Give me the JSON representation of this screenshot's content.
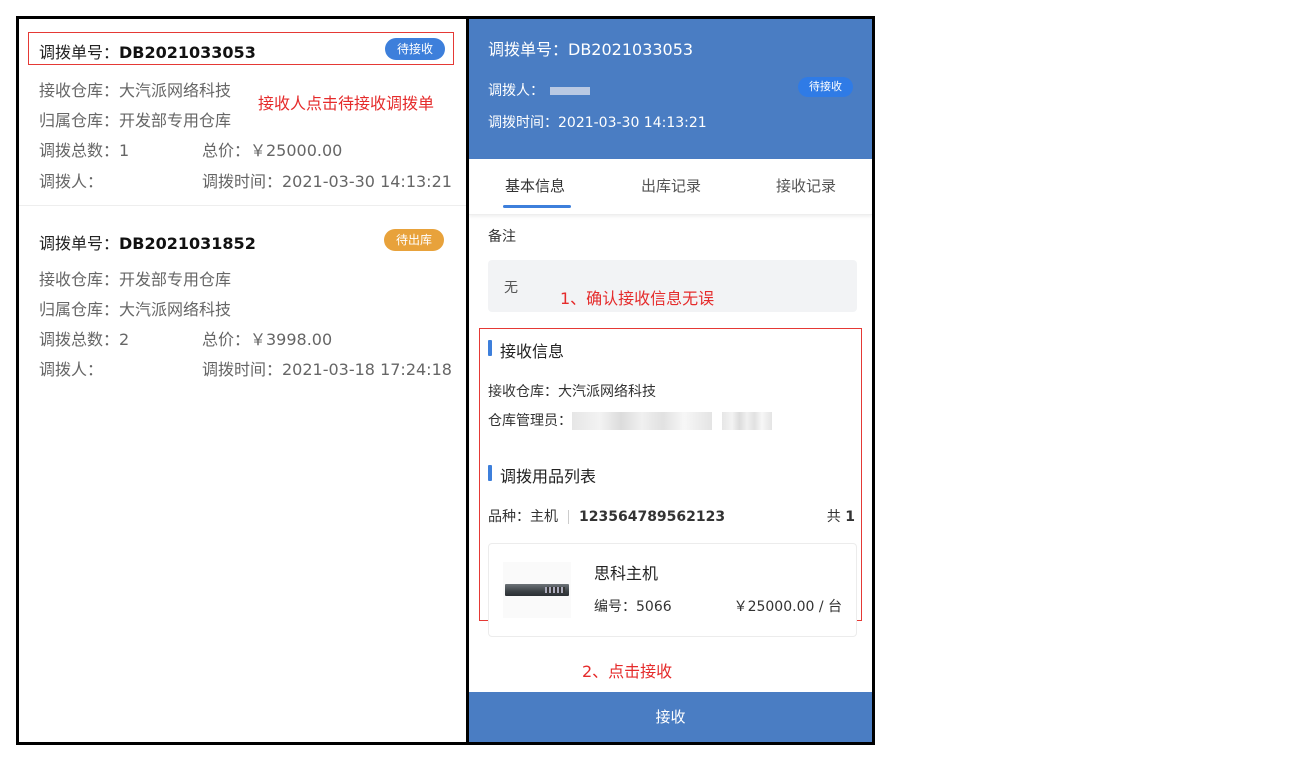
{
  "list": {
    "cards": [
      {
        "order_label": "调拨单号：",
        "order_no": "DB2021033053",
        "status": "待接收",
        "receive_wh": "接收仓库：大汽派网络科技",
        "owner_wh": "归属仓库：开发部专用仓库",
        "total_qty": "调拨总数：1",
        "total_price": "总价：￥25000.00",
        "transferrer": "调拨人：",
        "time": "调拨时间：2021-03-30 14:13:21"
      },
      {
        "order_label": "调拨单号：",
        "order_no": "DB2021031852",
        "status": "待出库",
        "receive_wh": "接收仓库：开发部专用仓库",
        "owner_wh": "归属仓库：大汽派网络科技",
        "total_qty": "调拨总数：2",
        "total_price": "总价：￥3998.00",
        "transferrer": "调拨人：",
        "time": "调拨时间：2021-03-18 17:24:18"
      }
    ]
  },
  "annotations": {
    "step0": "接收人点击待接收调拨单",
    "step1": "1、确认接收信息无误",
    "step2": "2、点击接收"
  },
  "detail": {
    "header": {
      "order": "调拨单号：DB2021033053",
      "transferrer_label": "调拨人：",
      "status": "待接收",
      "time": "调拨时间：2021-03-30 14:13:21"
    },
    "tabs": [
      "基本信息",
      "出库记录",
      "接收记录"
    ],
    "remark_title": "备注",
    "remark_value": "无",
    "receive_section": "接收信息",
    "receive_wh": "接收仓库：大汽派网络科技",
    "manager_label": "仓库管理员：",
    "items_section": "调拨用品列表",
    "category_label": "品种：主机",
    "category_code": "123564789562123",
    "count_label": "共",
    "count_value": "1",
    "product": {
      "name": "思科主机",
      "code": "编号：5066",
      "price": "￥25000.00 / 台"
    },
    "receive_button": "接收"
  },
  "colors": {
    "primary": "#4a7dc3",
    "badge_blue": "#3d7fdb",
    "badge_orange": "#e8a23b",
    "annotation_red": "#e52b2b"
  }
}
